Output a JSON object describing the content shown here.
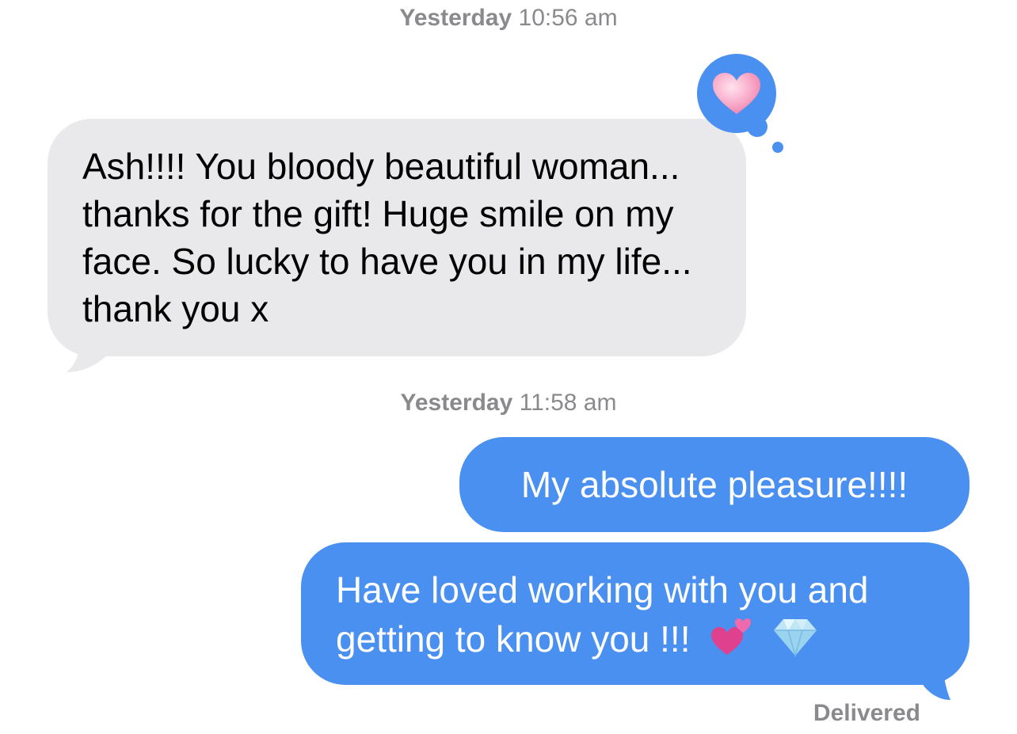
{
  "thread": {
    "timestamp1": {
      "day": "Yesterday",
      "time": "10:56 am"
    },
    "incoming_message": "Ash!!!!  You bloody beautiful woman... thanks for the gift! Huge smile on my face. So lucky to have you in my life... thank you x",
    "incoming_reaction": "heart-icon",
    "timestamp2": {
      "day": "Yesterday",
      "time": "11:58 am"
    },
    "outgoing_message_1": "My absolute pleasure!!!!",
    "outgoing_message_2": "Have loved working with you and getting to know you !!!",
    "outgoing_message_2_emojis": [
      "two-hearts-icon",
      "gem-icon"
    ],
    "status": "Delivered"
  },
  "colors": {
    "incoming_bubble": "#e9e9eb",
    "outgoing_bubble": "#4a90f0",
    "tapback": "#4a90f0",
    "timestamp": "#8a8a8e"
  }
}
